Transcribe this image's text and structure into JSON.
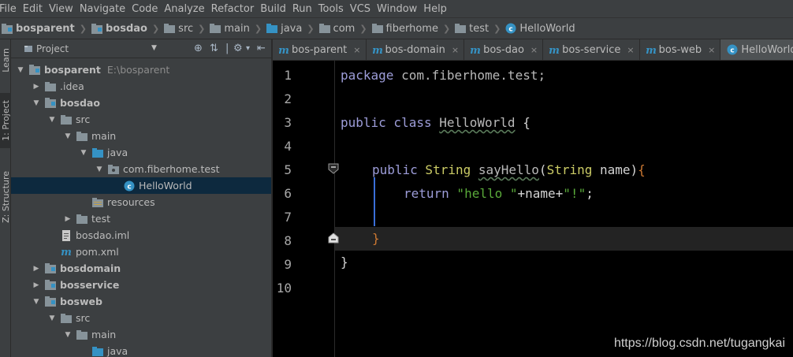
{
  "menu": [
    "File",
    "Edit",
    "View",
    "Navigate",
    "Code",
    "Analyze",
    "Refactor",
    "Build",
    "Run",
    "Tools",
    "VCS",
    "Window",
    "Help"
  ],
  "breadcrumbs": [
    {
      "label": "bosparent",
      "icon": "module-icon",
      "bold": true
    },
    {
      "label": "bosdao",
      "icon": "module-icon",
      "bold": true
    },
    {
      "label": "src",
      "icon": "folder-icon",
      "bold": false
    },
    {
      "label": "main",
      "icon": "folder-icon",
      "bold": false
    },
    {
      "label": "java",
      "icon": "source-folder-icon",
      "bold": false
    },
    {
      "label": "com",
      "icon": "folder-icon",
      "bold": false
    },
    {
      "label": "fiberhome",
      "icon": "folder-icon",
      "bold": false
    },
    {
      "label": "test",
      "icon": "folder-icon",
      "bold": false
    },
    {
      "label": "HelloWorld",
      "icon": "class-icon",
      "bold": false
    }
  ],
  "side_tabs": {
    "learn": "Learn",
    "project": "1: Project",
    "structure": "Z: Structure"
  },
  "project_panel": {
    "title": "Project"
  },
  "tree": [
    {
      "label": "bosparent",
      "sub": "E:\\bosparent",
      "depth": 0,
      "arrow": "down",
      "icon": "module-icon",
      "bold": true
    },
    {
      "label": ".idea",
      "sub": "",
      "depth": 1,
      "arrow": "right",
      "icon": "folder-icon",
      "bold": false
    },
    {
      "label": "bosdao",
      "sub": "",
      "depth": 1,
      "arrow": "down",
      "icon": "module-icon",
      "bold": true
    },
    {
      "label": "src",
      "sub": "",
      "depth": 2,
      "arrow": "down",
      "icon": "folder-icon",
      "bold": false
    },
    {
      "label": "main",
      "sub": "",
      "depth": 3,
      "arrow": "down",
      "icon": "folder-icon",
      "bold": false
    },
    {
      "label": "java",
      "sub": "",
      "depth": 4,
      "arrow": "down",
      "icon": "source-folder-icon",
      "bold": false
    },
    {
      "label": "com.fiberhome.test",
      "sub": "",
      "depth": 5,
      "arrow": "down",
      "icon": "package-icon",
      "bold": false
    },
    {
      "label": "HelloWorld",
      "sub": "",
      "depth": 6,
      "arrow": "none",
      "icon": "class-icon",
      "bold": false,
      "selected": true
    },
    {
      "label": "resources",
      "sub": "",
      "depth": 4,
      "arrow": "none",
      "icon": "resources-folder-icon",
      "bold": false
    },
    {
      "label": "test",
      "sub": "",
      "depth": 3,
      "arrow": "right",
      "icon": "folder-icon",
      "bold": false
    },
    {
      "label": "bosdao.iml",
      "sub": "",
      "depth": 2,
      "arrow": "none",
      "icon": "iml-file-icon",
      "bold": false
    },
    {
      "label": "pom.xml",
      "sub": "",
      "depth": 2,
      "arrow": "none",
      "icon": "maven-icon",
      "bold": false
    },
    {
      "label": "bosdomain",
      "sub": "",
      "depth": 1,
      "arrow": "right",
      "icon": "module-icon",
      "bold": true
    },
    {
      "label": "bosservice",
      "sub": "",
      "depth": 1,
      "arrow": "right",
      "icon": "module-icon",
      "bold": true
    },
    {
      "label": "bosweb",
      "sub": "",
      "depth": 1,
      "arrow": "down",
      "icon": "module-icon",
      "bold": true
    },
    {
      "label": "src",
      "sub": "",
      "depth": 2,
      "arrow": "down",
      "icon": "folder-icon",
      "bold": false
    },
    {
      "label": "main",
      "sub": "",
      "depth": 3,
      "arrow": "down",
      "icon": "folder-icon",
      "bold": false
    },
    {
      "label": "java",
      "sub": "",
      "depth": 4,
      "arrow": "none",
      "icon": "source-folder-icon",
      "bold": false
    }
  ],
  "tabs": [
    {
      "label": "bos-parent",
      "icon": "maven-icon",
      "active": false
    },
    {
      "label": "bos-domain",
      "icon": "maven-icon",
      "active": false
    },
    {
      "label": "bos-dao",
      "icon": "maven-icon",
      "active": false
    },
    {
      "label": "bos-service",
      "icon": "maven-icon",
      "active": false
    },
    {
      "label": "bos-web",
      "icon": "maven-icon",
      "active": false
    },
    {
      "label": "HelloWorld.java",
      "icon": "class-icon",
      "active": true
    }
  ],
  "line_numbers": [
    "1",
    "2",
    "3",
    "4",
    "5",
    "6",
    "7",
    "8",
    "9",
    "10"
  ],
  "code": {
    "l1_kw": "package",
    "l1_pkg": " com.fiberhome.test;",
    "l3_kw": "public class",
    "l3_cls": "HelloWorld",
    "l3_rest": " {",
    "l5_kw": "public",
    "l5_type": " String ",
    "l5_meth": "sayHello",
    "l5_paren": "(",
    "l5_ptype": "String",
    "l5_pname": " name)",
    "l5_brace": "{",
    "l6_kw": "return",
    "l6_s1": " \"hello \"",
    "l6_plus1": "+name+",
    "l6_s2": "\"!\"",
    "l6_end": ";",
    "l8_brace": "}",
    "l9_brace": "}"
  },
  "watermark": "https://blog.csdn.net/tugangkai",
  "colors": {
    "background": "#3c3f41",
    "editor": "#000000",
    "selection": "#0d293e",
    "keyword": "#9d9dd9",
    "string": "#5aaa3a",
    "type": "#cccc66"
  }
}
